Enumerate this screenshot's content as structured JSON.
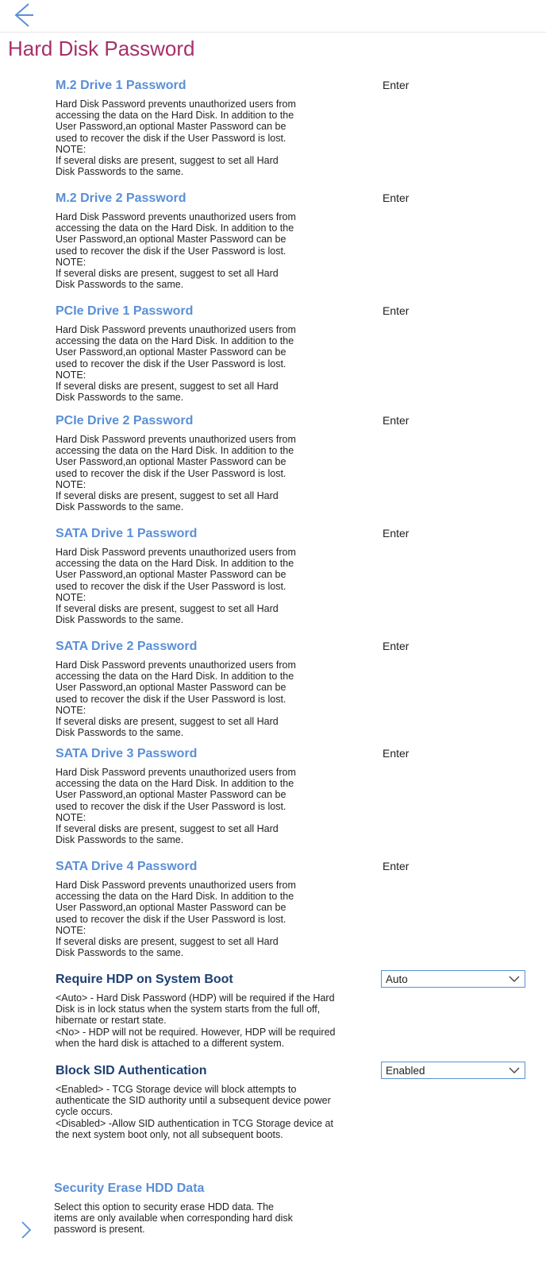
{
  "page": {
    "title": "Hard Disk Password"
  },
  "icons": {
    "back": "arrow-left-icon",
    "chevron": "chevron-down-icon",
    "submenu": "chevron-right-icon"
  },
  "colors": {
    "title": "#a6306a",
    "link": "#5a8fd6",
    "dark_link": "#1e3f73"
  },
  "description_text": "Hard Disk Password prevents unauthorized users from\naccessing the data on the Hard Disk. In addition to the\nUser Password,an optional Master Password can be\nused to recover the disk if the User Password is lost.\nNOTE:\nIf several disks are present, suggest to set all Hard\nDisk Passwords to the same.",
  "drives": [
    {
      "label": "M.2 Drive 1 Password",
      "value": "Enter"
    },
    {
      "label": "M.2 Drive 2 Password",
      "value": "Enter"
    },
    {
      "label": "PCIe Drive 1 Password",
      "value": "Enter"
    },
    {
      "label": "PCIe Drive 2 Password",
      "value": "Enter"
    },
    {
      "label": "SATA Drive 1 Password",
      "value": "Enter"
    },
    {
      "label": "SATA Drive 2 Password",
      "value": "Enter"
    },
    {
      "label": "SATA Drive 3 Password",
      "value": "Enter"
    },
    {
      "label": "SATA Drive 4 Password",
      "value": "Enter"
    }
  ],
  "require_hdp": {
    "label": "Require HDP on System Boot",
    "value": "Auto",
    "description": "<Auto> - Hard Disk Password (HDP) will be required if the Hard\nDisk is in lock status when the system starts from the full off,\nhibernate or restart state.\n<No> - HDP will not be required. However, HDP will be required\nwhen the hard disk is attached to a different system."
  },
  "block_sid": {
    "label": "Block SID Authentication",
    "value": "Enabled",
    "description": "<Enabled> - TCG Storage device will block attempts to\nauthenticate the SID authority until a subsequent device power\ncycle occurs.\n<Disabled> -Allow SID authentication in TCG Storage device at\nthe next system boot only, not all subsequent boots."
  },
  "security_erase": {
    "label": "Security Erase HDD Data",
    "description": "Select this option to security erase HDD data. The\nitems are only available when corresponding hard disk\npassword is present."
  }
}
